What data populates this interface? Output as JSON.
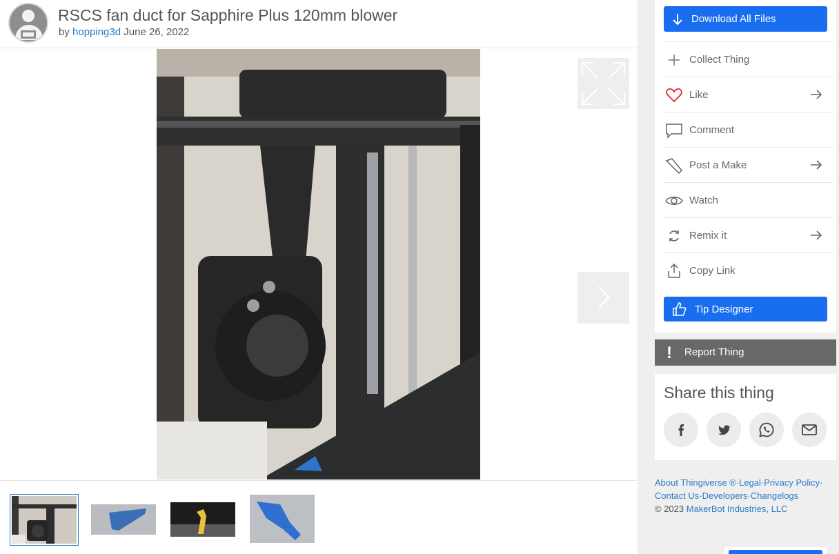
{
  "thing": {
    "title": "RSCS fan duct for Sapphire Plus 120mm blower",
    "by_label": "by",
    "author": "hopping3d",
    "date": "June 26, 2022"
  },
  "viewer": {
    "expand_icon": "expand-icon",
    "next_icon": "chevron-right-icon",
    "thumbnail_count": 4,
    "active_thumbnail": 1
  },
  "actions": {
    "download": "Download All Files",
    "items": [
      {
        "label": "Collect Thing",
        "icon": "plus-icon"
      },
      {
        "label": "Like",
        "icon": "heart-icon",
        "arrow": true
      },
      {
        "label": "Comment",
        "icon": "comment-icon"
      },
      {
        "label": "Post a Make",
        "icon": "make-icon",
        "arrow": true
      },
      {
        "label": "Watch",
        "icon": "eye-icon"
      },
      {
        "label": "Remix it",
        "icon": "remix-icon",
        "arrow": true
      },
      {
        "label": "Copy Link",
        "icon": "share-link-icon"
      }
    ],
    "tip": "Tip Designer"
  },
  "report": {
    "label": "Report Thing"
  },
  "share": {
    "heading": "Share this thing",
    "networks": [
      "facebook-icon",
      "twitter-icon",
      "whatsapp-icon",
      "email-icon"
    ]
  },
  "footer": {
    "about": "About Thingiverse ®",
    "legal": "Legal",
    "privacy": "Privacy Policy",
    "contact": "Contact Us",
    "developers": "Developers",
    "changelogs": "Changelogs",
    "sep": "·",
    "copyright_prefix": "©  2023",
    "company": "MakerBot Industries, LLC"
  },
  "colors": {
    "accent": "#196ef0",
    "link": "#2d7bc6",
    "like": "#e0262b",
    "report_bg": "#686868"
  }
}
